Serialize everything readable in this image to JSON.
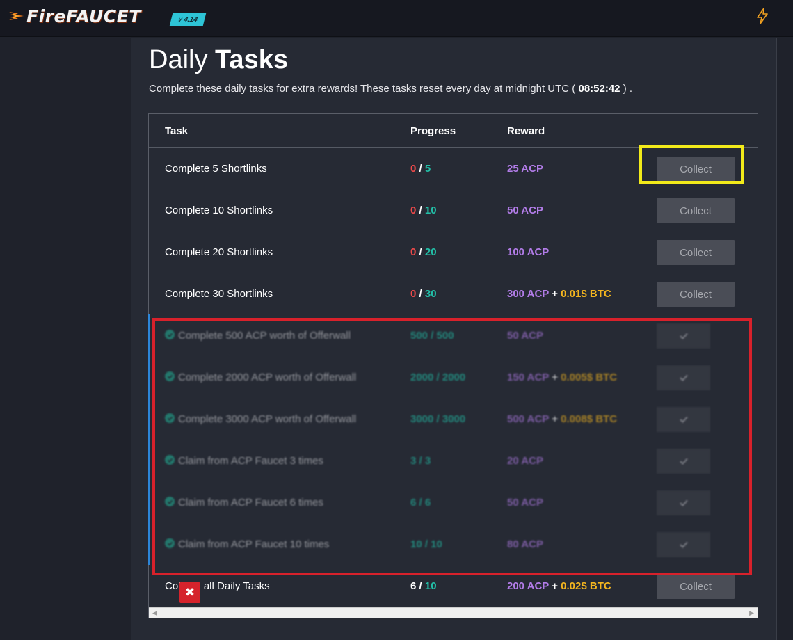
{
  "header": {
    "logo_text": "FireFAUCET",
    "version": "v 4.14",
    "bolt_icon": "lightning-bolt-icon"
  },
  "page": {
    "title_light": "Daily",
    "title_bold": "Tasks",
    "subtitle_pre": "Complete these daily tasks for extra rewards! These tasks reset every day at midnight UTC (",
    "countdown": "08:52:42",
    "subtitle_post": ") ."
  },
  "table": {
    "columns": [
      "Task",
      "Progress",
      "Reward"
    ],
    "rows": [
      {
        "task": "Complete 5 Shortlinks",
        "progress_current": "0",
        "progress_sep": " / ",
        "progress_total": "5",
        "reward_acp": "25 ACP",
        "reward_plus": "",
        "reward_btc": "",
        "action": "Collect"
      },
      {
        "task": "Complete 10 Shortlinks",
        "progress_current": "0",
        "progress_sep": " / ",
        "progress_total": "10",
        "reward_acp": "50 ACP",
        "reward_plus": "",
        "reward_btc": "",
        "action": "Collect"
      },
      {
        "task": "Complete 20 Shortlinks",
        "progress_current": "0",
        "progress_sep": " / ",
        "progress_total": "20",
        "reward_acp": "100 ACP",
        "reward_plus": "",
        "reward_btc": "",
        "action": "Collect"
      },
      {
        "task": "Complete 30 Shortlinks",
        "progress_current": "0",
        "progress_sep": " / ",
        "progress_total": "30",
        "reward_acp": "300 ACP",
        "reward_plus": " + ",
        "reward_btc": "0.01$ BTC",
        "action": "Collect"
      }
    ],
    "done_rows": [
      {
        "task": "Complete 500 ACP worth of Offerwall",
        "progress": "500 / 500",
        "reward_acp": "50 ACP",
        "reward_plus": "",
        "reward_btc": ""
      },
      {
        "task": "Complete 2000 ACP worth of Offerwall",
        "progress": "2000 / 2000",
        "reward_acp": "150 ACP",
        "reward_plus": " + ",
        "reward_btc": "0.005$ BTC"
      },
      {
        "task": "Complete 3000 ACP worth of Offerwall",
        "progress": "3000 / 3000",
        "reward_acp": "500 ACP",
        "reward_plus": " + ",
        "reward_btc": "0.008$ BTC"
      },
      {
        "task": "Claim from ACP Faucet 3 times",
        "progress": "3 / 3",
        "reward_acp": "20 ACP",
        "reward_plus": "",
        "reward_btc": ""
      },
      {
        "task": "Claim from ACP Faucet 6 times",
        "progress": "6 / 6",
        "reward_acp": "50 ACP",
        "reward_plus": "",
        "reward_btc": ""
      },
      {
        "task": "Claim from ACP Faucet 10 times",
        "progress": "10 / 10",
        "reward_acp": "80 ACP",
        "reward_plus": "",
        "reward_btc": ""
      }
    ],
    "final_row": {
      "task_pre": "Coll",
      "task_post": "all Daily Tasks",
      "progress_current": "6",
      "progress_sep": " / ",
      "progress_total": "10",
      "reward_acp": "200 ACP",
      "reward_plus": " + ",
      "reward_btc": "0.02$ BTC",
      "action": "Collect"
    }
  },
  "overlay": {
    "close_glyph": "✖",
    "yellow_box": "highlight-collect",
    "red_box": "highlight-completed-tasks"
  },
  "colors": {
    "progress_zero": "#f04a4a",
    "progress_total": "#22c0a8",
    "reward_acp": "#b27ce8",
    "reward_btc": "#f3b51f",
    "highlight_yellow": "#f2ea1a",
    "highlight_red": "#d8212b"
  }
}
